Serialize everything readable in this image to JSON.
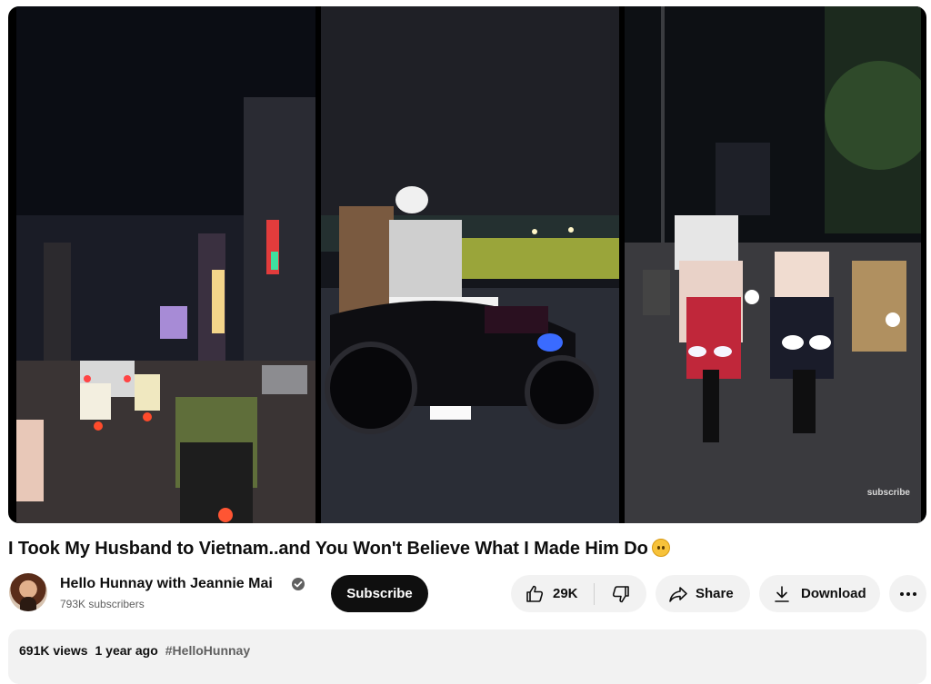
{
  "video": {
    "watermark": "subscribe"
  },
  "title": "I Took My Husband to Vietnam..and You Won't Believe What I Made Him Do",
  "channel": {
    "name": "Hello Hunnay with Jeannie Mai",
    "subscribers": "793K subscribers",
    "subscribe_label": "Subscribe"
  },
  "actions": {
    "like_count": "29K",
    "share_label": "Share",
    "download_label": "Download"
  },
  "description": {
    "views": "691K views",
    "date": "1 year ago",
    "hashtag": "#HelloHunnay"
  },
  "icons": {
    "emoji": "upside-down-face-icon",
    "verified": "verified-check-icon",
    "like": "thumbs-up-icon",
    "dislike": "thumbs-down-icon",
    "share": "share-arrow-icon",
    "download": "download-icon",
    "more": "more-horizontal-icon"
  },
  "colors": {
    "subscribe_bg": "#0f0f0f",
    "pill_bg": "#f2f2f2",
    "secondary_text": "#606060"
  }
}
